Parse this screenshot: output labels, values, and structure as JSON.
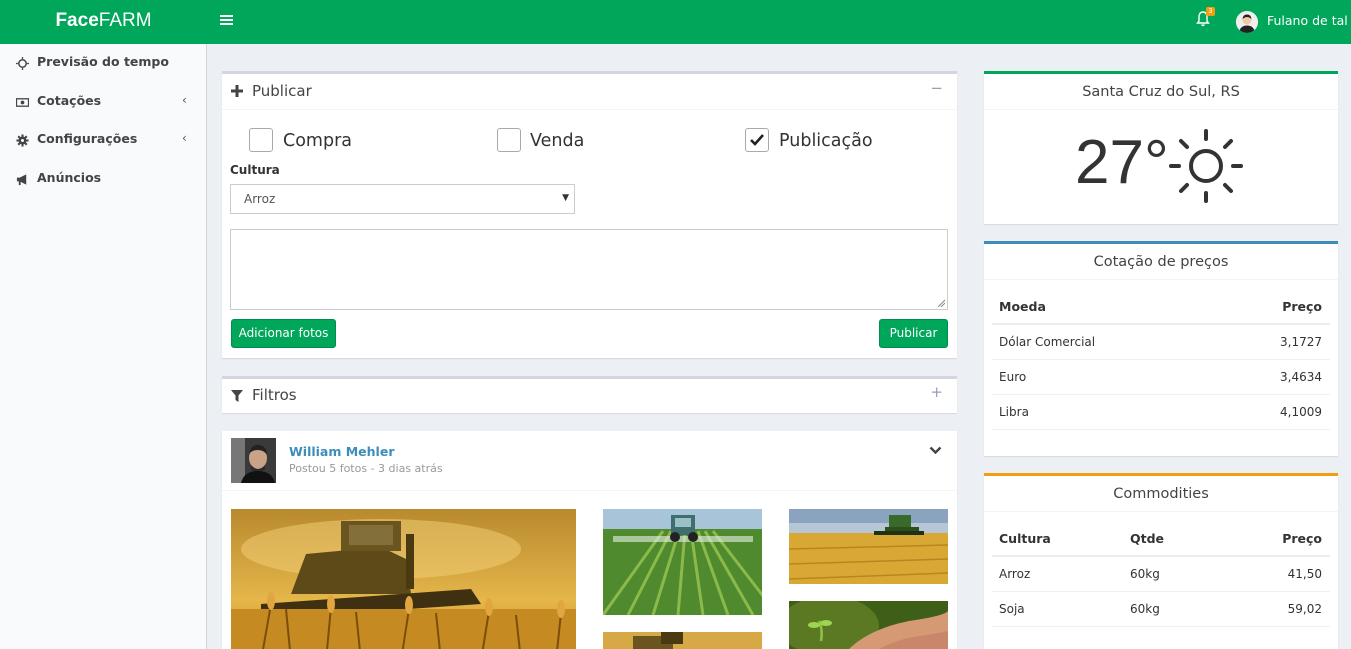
{
  "brand": {
    "prefix": "Face",
    "suffix": "FARM"
  },
  "header": {
    "notification_count": "3",
    "user_name": "Fulano de tal"
  },
  "sidebar": {
    "items": [
      {
        "label": "Previsão do tempo",
        "icon": "sun-icon"
      },
      {
        "label": "Cotações",
        "icon": "money-icon"
      },
      {
        "label": "Configurações",
        "icon": "gear-icon"
      },
      {
        "label": "Anúncios",
        "icon": "megaphone-icon"
      }
    ]
  },
  "publish": {
    "title": "Publicar",
    "options": [
      {
        "label": "Compra",
        "checked": false
      },
      {
        "label": "Venda",
        "checked": false
      },
      {
        "label": "Publicação",
        "checked": true
      }
    ],
    "culture_label": "Cultura",
    "culture_value": "Arroz",
    "add_photos_label": "Adicionar fotos",
    "submit_label": "Publicar"
  },
  "filters": {
    "title": "Filtros"
  },
  "post": {
    "author": "William Mehler",
    "description": "Postou 5 fotos - 3 dias atrás"
  },
  "weather": {
    "city": "Santa Cruz do Sul, RS",
    "temperature": "27°",
    "condition_icon": "sun-icon"
  },
  "quotes": {
    "title": "Cotação de preços",
    "headers": [
      "Moeda",
      "Preço"
    ],
    "rows": [
      [
        "Dólar Comercial",
        "3,1727"
      ],
      [
        "Euro",
        "3,4634"
      ],
      [
        "Libra",
        "4,1009"
      ]
    ]
  },
  "commodities": {
    "title": "Commodities",
    "headers": [
      "Cultura",
      "Qtde",
      "Preço"
    ],
    "rows": [
      [
        "Arroz",
        "60kg",
        "41,50"
      ],
      [
        "Soja",
        "60kg",
        "59,02"
      ]
    ]
  },
  "colors": {
    "brand": "#00a65a",
    "quotes_accent": "#3c8dbc",
    "commodities_accent": "#f39c12",
    "link": "#3c8dbc"
  }
}
